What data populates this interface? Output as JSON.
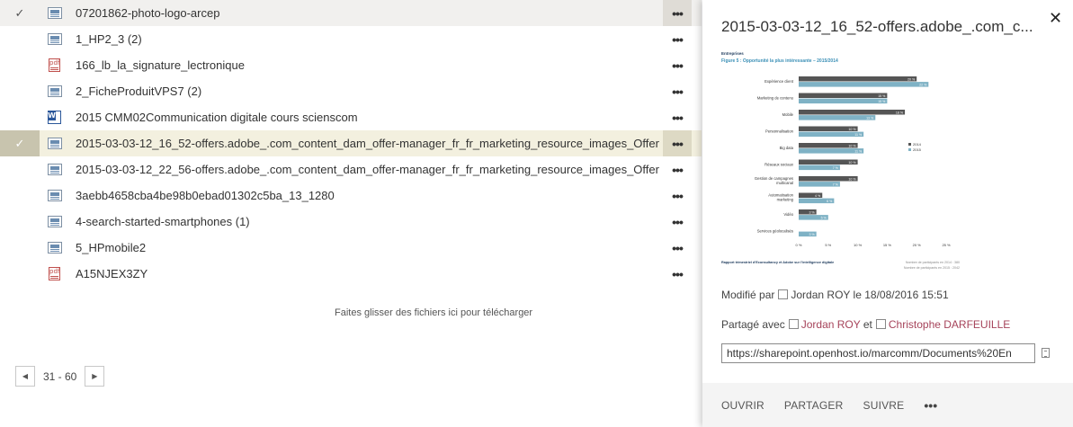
{
  "files": [
    {
      "name": "07201862-photo-logo-arcep",
      "type": "image",
      "state": "highlight",
      "checked": true
    },
    {
      "name": "1_HP2_3 (2)",
      "type": "image",
      "state": "",
      "checked": false
    },
    {
      "name": "166_lb_la_signature_lectronique",
      "type": "pdf",
      "state": "",
      "checked": false
    },
    {
      "name": "2_FicheProduitVPS7 (2)",
      "type": "image",
      "state": "",
      "checked": false
    },
    {
      "name": "2015 CMM02Communication digitale cours scienscom",
      "type": "word",
      "state": "",
      "checked": false
    },
    {
      "name": "2015-03-03-12_16_52-offers.adobe_.com_content_dam_offer-manager_fr_fr_marketing_resource_images_Offer",
      "type": "image",
      "state": "selected",
      "checked": true
    },
    {
      "name": "2015-03-03-12_22_56-offers.adobe_.com_content_dam_offer-manager_fr_fr_marketing_resource_images_Offer",
      "type": "image",
      "state": "",
      "checked": false
    },
    {
      "name": "3aebb4658cba4be98b0ebad01302c5ba_13_1280",
      "type": "image",
      "state": "",
      "checked": false
    },
    {
      "name": "4-search-started-smartphones (1)",
      "type": "image",
      "state": "",
      "checked": false
    },
    {
      "name": "5_HPmobile2",
      "type": "image",
      "state": "",
      "checked": false
    },
    {
      "name": "A15NJEX3ZY",
      "type": "pdf",
      "state": "",
      "checked": false
    }
  ],
  "list": {
    "check_glyph": "✓",
    "more_glyph": "•••",
    "drop_hint": "Faites glisser des fichiers ici pour télécharger"
  },
  "pager": {
    "prev_glyph": "◀",
    "next_glyph": "▶",
    "range": "31 - 60"
  },
  "panel": {
    "title": "2015-03-03-12_16_52-offers.adobe_.com_c...",
    "close_glyph": "✕",
    "modified_label": "Modifié par",
    "modified_user": "Jordan ROY",
    "modified_on_label": "le",
    "modified_date": "18/08/2016 15:51",
    "shared_label": "Partagé avec",
    "shared_user1": "Jordan ROY",
    "shared_and": "et",
    "shared_user2": "Christophe DARFEUILLE",
    "url": "https://sharepoint.openhost.io/marcomm/Documents%20En",
    "footer": {
      "open": "OUVRIR",
      "share": "PARTAGER",
      "follow": "SUIVRE",
      "more": "•••"
    }
  },
  "preview_chart": {
    "kicker": "Entreprises",
    "title": "Figure 5 : Opportunité la plus intéressante – 2015/2014",
    "source": "Rapport trimestriel d'Econsultancy et Adobe sur l'intelligence digitale",
    "sample_note1": "Nombre de participants en 2014 : 380",
    "sample_note2": "Nombre de participants en 2015 : 2042",
    "colors": {
      "2014": "#555555",
      "2015": "#7fb2c5"
    },
    "chart_data": {
      "type": "bar",
      "orientation": "horizontal",
      "categories": [
        "Expérience client",
        "Marketing de contenu",
        "Mobile",
        "Personnalisation",
        "Big data",
        "Réseaux sociaux",
        "Gestion de campagnes multicanal",
        "Automatisation marketing",
        "Vidéo",
        "Services géolocalisés"
      ],
      "series": [
        {
          "name": "2014",
          "values": [
            20,
            15,
            18,
            10,
            10,
            10,
            10,
            4,
            3,
            null
          ]
        },
        {
          "name": "2015",
          "values": [
            22,
            15,
            13,
            11,
            11,
            7,
            7,
            6,
            5,
            3
          ]
        }
      ],
      "value_labels": {
        "2014": [
          "20 %",
          "15 %",
          "18 %",
          "10 %",
          "10 %",
          "10 %",
          "10 %",
          "4 %",
          "3 %",
          ""
        ],
        "2015": [
          "22 %",
          "15 %",
          "13 %",
          "11 %",
          "11 %",
          "7 %",
          "7 %",
          "6 %",
          "5 %",
          "3 %"
        ]
      },
      "xticks": [
        "0 %",
        "5 %",
        "10 %",
        "15 %",
        "20 %",
        "25 %"
      ],
      "xlim": [
        0,
        25
      ],
      "legend": "right"
    }
  }
}
